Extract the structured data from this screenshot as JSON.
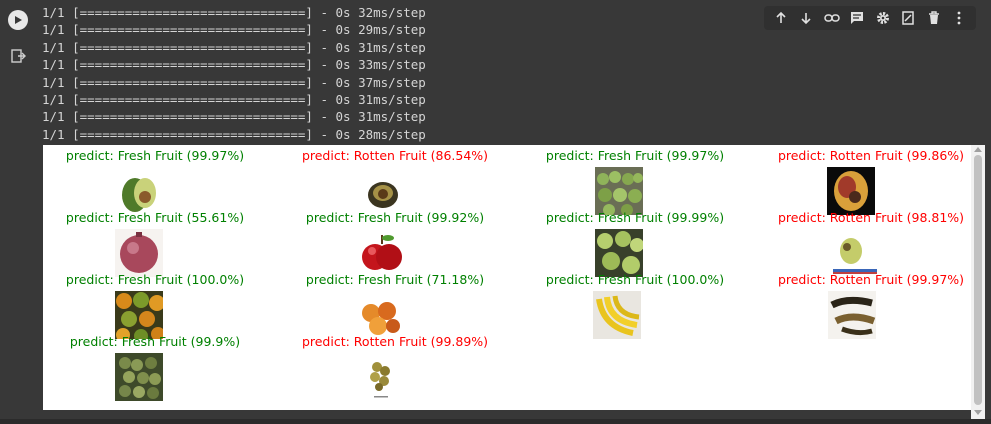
{
  "log_lines": [
    "1/1 [==============================] - 0s 32ms/step",
    "1/1 [==============================] - 0s 29ms/step",
    "1/1 [==============================] - 0s 31ms/step",
    "1/1 [==============================] - 0s 33ms/step",
    "1/1 [==============================] - 0s 37ms/step",
    "1/1 [==============================] - 0s 31ms/step",
    "1/1 [==============================] - 0s 31ms/step",
    "1/1 [==============================] - 0s 28ms/step"
  ],
  "colors": {
    "fresh": "#008000",
    "rotten": "#ff0000"
  },
  "predictions": [
    {
      "label": "predict: Fresh Fruit (99.97%)",
      "class": "fresh",
      "image": "avocado-photo"
    },
    {
      "label": "predict: Rotten Fruit (86.54%)",
      "class": "rotten",
      "image": "rotten-avocado-photo"
    },
    {
      "label": "predict: Fresh Fruit (99.97%)",
      "class": "fresh",
      "image": "guava-crate-photo"
    },
    {
      "label": "predict: Rotten Fruit (99.86%)",
      "class": "rotten",
      "image": "rotten-mango-photo"
    },
    {
      "label": "predict: Fresh Fruit (55.61%)",
      "class": "fresh",
      "image": "pomegranate-photo"
    },
    {
      "label": "predict: Fresh Fruit (99.92%)",
      "class": "fresh",
      "image": "red-apple-photo"
    },
    {
      "label": "predict: Fresh Fruit (99.99%)",
      "class": "fresh",
      "image": "guava-pile-photo"
    },
    {
      "label": "predict: Rotten Fruit (98.81%)",
      "class": "rotten",
      "image": "rotten-guava-photo"
    },
    {
      "label": "predict: Fresh Fruit (100.0%)",
      "class": "fresh",
      "image": "oranges-photo"
    },
    {
      "label": "predict: Fresh Fruit (71.18%)",
      "class": "fresh",
      "image": "apricots-photo"
    },
    {
      "label": "predict: Fresh Fruit (100.0%)",
      "class": "fresh",
      "image": "bananas-photo"
    },
    {
      "label": "predict: Rotten Fruit (99.97%)",
      "class": "rotten",
      "image": "rotten-banana-photo"
    },
    {
      "label": "predict: Fresh Fruit (99.9%)",
      "class": "fresh",
      "image": "grapes-photo"
    },
    {
      "label": "predict: Rotten Fruit (99.89%)",
      "class": "rotten",
      "image": "rotten-grapes-photo"
    }
  ],
  "toolbar": [
    "move-up-icon",
    "move-down-icon",
    "link-icon",
    "comment-icon",
    "settings-icon",
    "mirror-cell-icon",
    "delete-icon",
    "more-icon"
  ]
}
